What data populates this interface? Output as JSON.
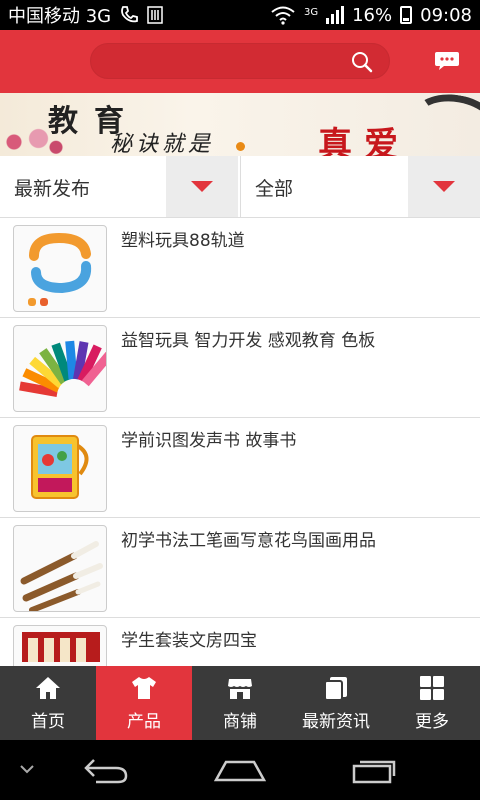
{
  "status_bar": {
    "carrier": "中国移动 3G",
    "network": "3G",
    "battery": "16%",
    "time": "09:08"
  },
  "header": {
    "search_placeholder": "",
    "search_icon": "search-icon",
    "message_icon": "chat-icon"
  },
  "banner": {
    "line1": "教育",
    "line2": "秘诀就是",
    "line3": "真爱",
    "active_slide": 1,
    "slide_count": 1
  },
  "filters": {
    "sort_label": "最新发布",
    "category_label": "全部"
  },
  "products": [
    {
      "name": "塑料玩具88轨道"
    },
    {
      "name": "益智玩具 智力开发 感观教育 色板"
    },
    {
      "name": "学前识图发声书 故事书"
    },
    {
      "name": "初学书法工笔画写意花鸟国画用品"
    },
    {
      "name": "学生套装文房四宝"
    }
  ],
  "tabs": [
    {
      "label": "首页",
      "icon": "home-icon",
      "active": false
    },
    {
      "label": "产品",
      "icon": "shirt-icon",
      "active": true
    },
    {
      "label": "商铺",
      "icon": "store-icon",
      "active": false
    },
    {
      "label": "最新资讯",
      "icon": "news-icon",
      "active": false
    },
    {
      "label": "更多",
      "icon": "grid-icon",
      "active": false
    }
  ],
  "colors": {
    "accent": "#e2353d",
    "tabbar_bg": "#3a3a3a"
  }
}
